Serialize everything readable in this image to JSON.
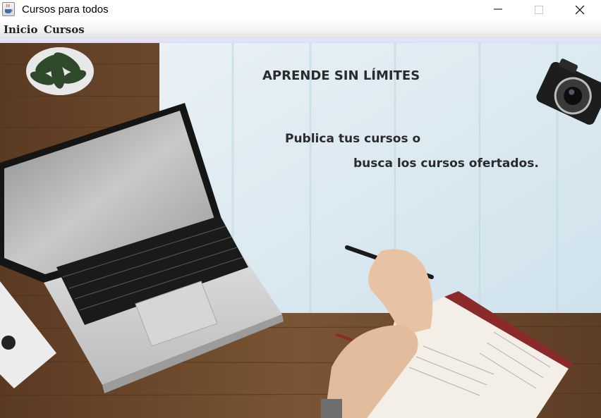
{
  "window": {
    "title": "Cursos para todos"
  },
  "menubar": {
    "items": [
      {
        "label": "Inicio"
      },
      {
        "label": "Cursos"
      }
    ]
  },
  "hero": {
    "title": "APRENDE SIN LÍMITES",
    "line1": "Publica tus cursos o",
    "line2": "busca los cursos ofertados."
  },
  "icons": {
    "app": "java-coffee-cup-icon",
    "minimize": "minimize-icon",
    "maximize": "maximize-icon",
    "close": "close-icon"
  },
  "colors": {
    "wood": "#6b4a2e",
    "paper": "#d9e7ef",
    "text": "#2b2b2b"
  }
}
